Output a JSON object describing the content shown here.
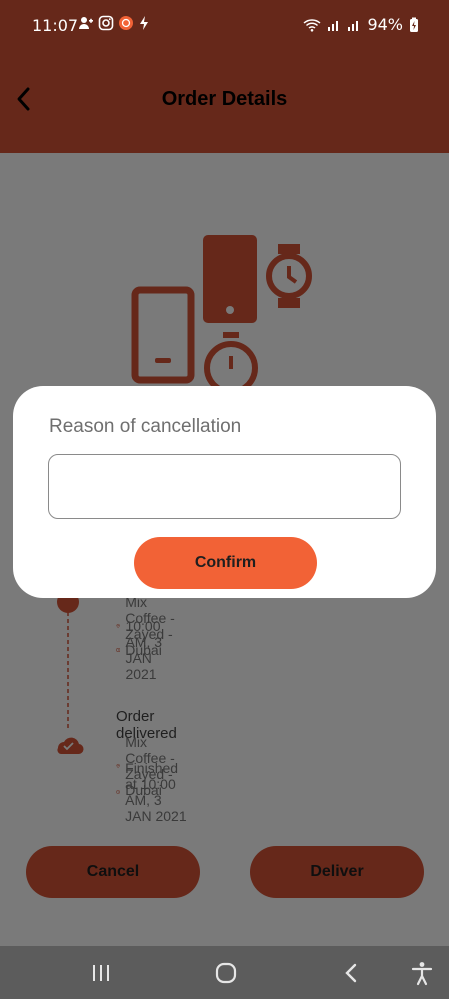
{
  "status_bar": {
    "time": "11:07",
    "battery": "94%"
  },
  "header": {
    "title": "Order Details"
  },
  "timeline": {
    "step1": {
      "location": "Mix Coffee - Zayed - Dubai",
      "time": "10:00 AM, 3 JAN 2021"
    },
    "step2": {
      "title": "Order delivered",
      "location": "Mix Coffee - Zayed - Dubai",
      "time": "Finished at 10:00 AM, 3 JAN 2021"
    }
  },
  "actions": {
    "cancel_label": "Cancel",
    "deliver_label": "Deliver"
  },
  "modal": {
    "title": "Reason of cancellation",
    "input_value": "",
    "input_placeholder": "",
    "confirm_label": "Confirm"
  },
  "colors": {
    "appbar": "#66281a",
    "accent": "#f26236",
    "dim_background": "#7a7a7a"
  },
  "icons": {
    "back": "chevron-left-icon",
    "location": "location-pin-icon",
    "clock": "clock-icon",
    "delivered": "cloud-check-icon"
  }
}
